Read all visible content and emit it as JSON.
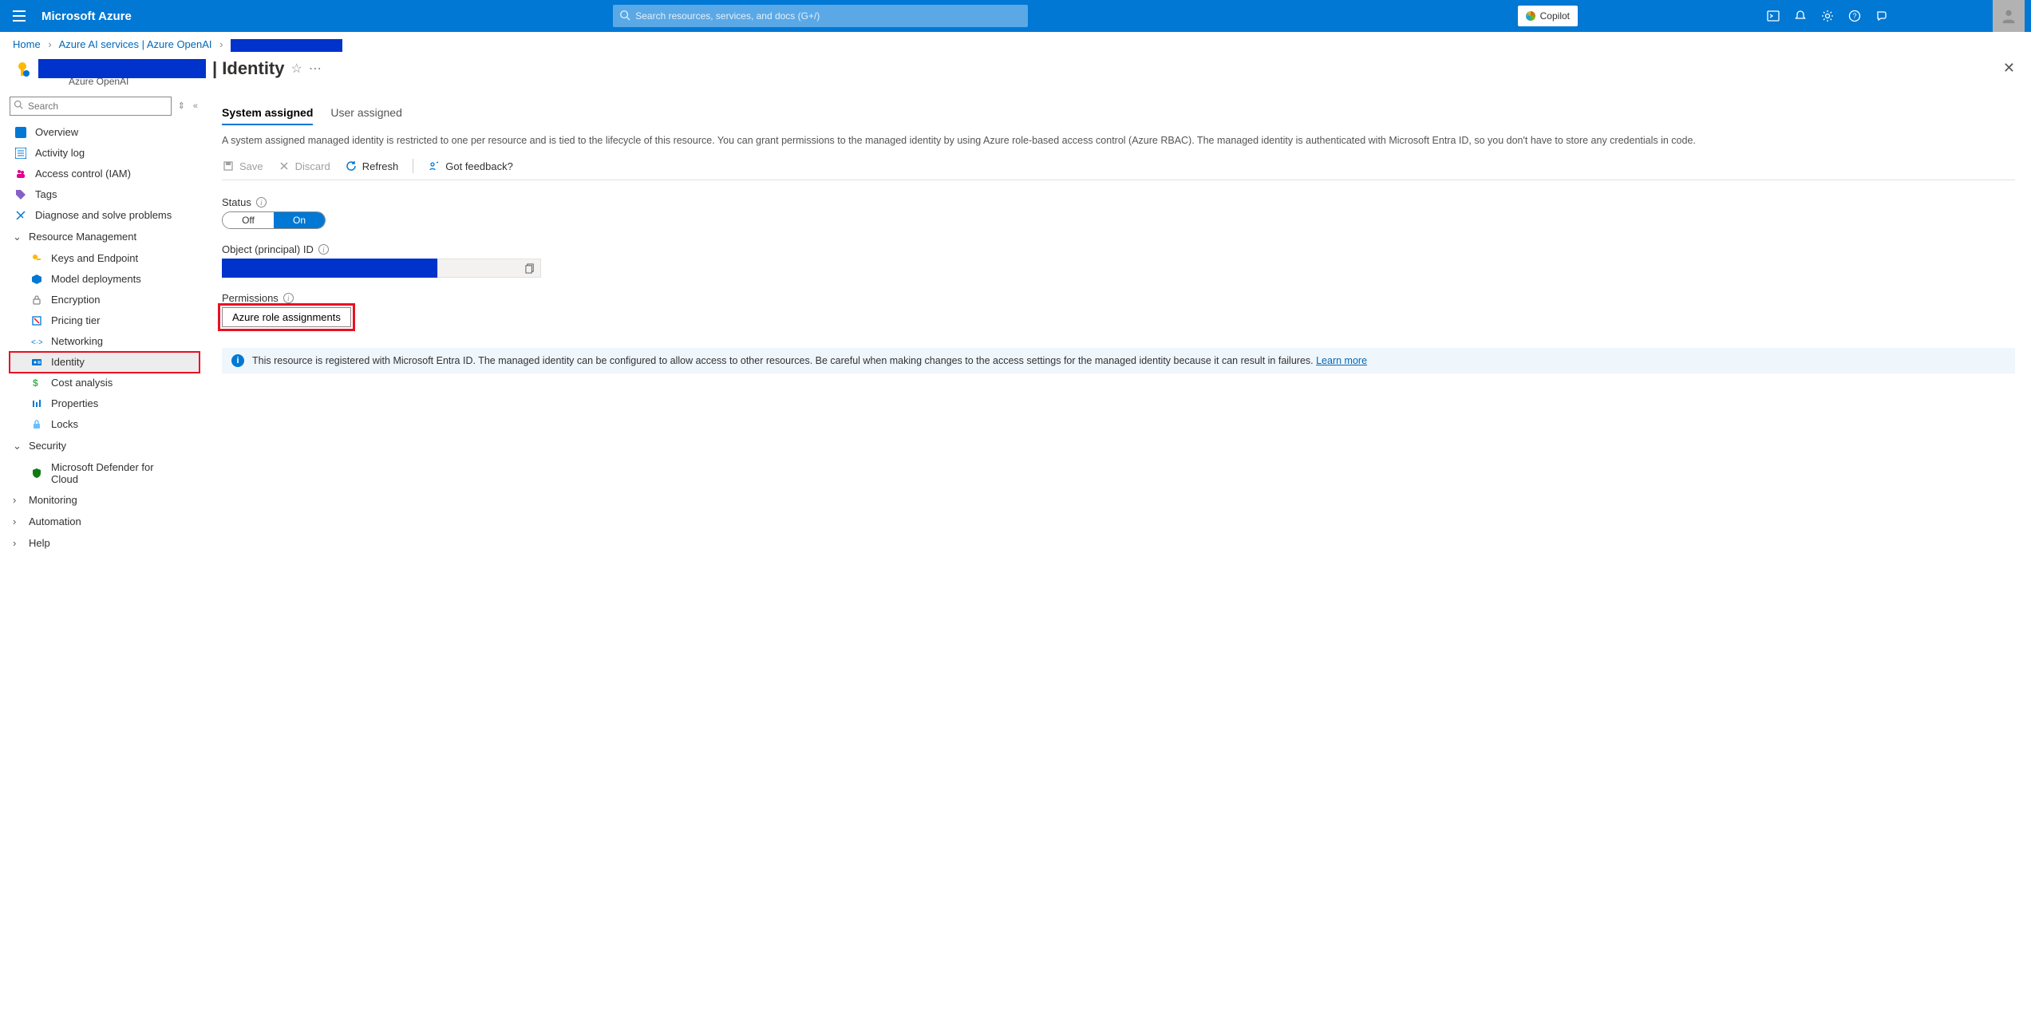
{
  "topbar": {
    "brand": "Microsoft Azure",
    "search_placeholder": "Search resources, services, and docs (G+/)",
    "copilot_label": "Copilot"
  },
  "breadcrumb": {
    "home": "Home",
    "svc": "Azure AI services | Azure OpenAI"
  },
  "title": {
    "suffix": "| Identity",
    "subtitle": "Azure OpenAI"
  },
  "left": {
    "search_placeholder": "Search",
    "overview": "Overview",
    "activity": "Activity log",
    "iam": "Access control (IAM)",
    "tags": "Tags",
    "diagnose": "Diagnose and solve problems",
    "group_rm": "Resource Management",
    "keys": "Keys and Endpoint",
    "model": "Model deployments",
    "encryption": "Encryption",
    "pricing": "Pricing tier",
    "networking": "Networking",
    "identity": "Identity",
    "cost": "Cost analysis",
    "properties": "Properties",
    "locks": "Locks",
    "group_sec": "Security",
    "defender": "Microsoft Defender for Cloud",
    "monitoring": "Monitoring",
    "automation": "Automation",
    "help": "Help"
  },
  "tabs": {
    "system": "System assigned",
    "user": "User assigned"
  },
  "desc": "A system assigned managed identity is restricted to one per resource and is tied to the lifecycle of this resource. You can grant permissions to the managed identity by using Azure role-based access control (Azure RBAC). The managed identity is authenticated with Microsoft Entra ID, so you don't have to store any credentials in code.",
  "toolbar": {
    "save": "Save",
    "discard": "Discard",
    "refresh": "Refresh",
    "feedback": "Got feedback?"
  },
  "form": {
    "status_label": "Status",
    "off": "Off",
    "on": "On",
    "objid_label": "Object (principal) ID",
    "perms_label": "Permissions",
    "perms_button": "Azure role assignments"
  },
  "banner": {
    "text": "This resource is registered with Microsoft Entra ID. The managed identity can be configured to allow access to other resources. Be careful when making changes to the access settings for the managed identity because it can result in failures. ",
    "link": "Learn more"
  }
}
